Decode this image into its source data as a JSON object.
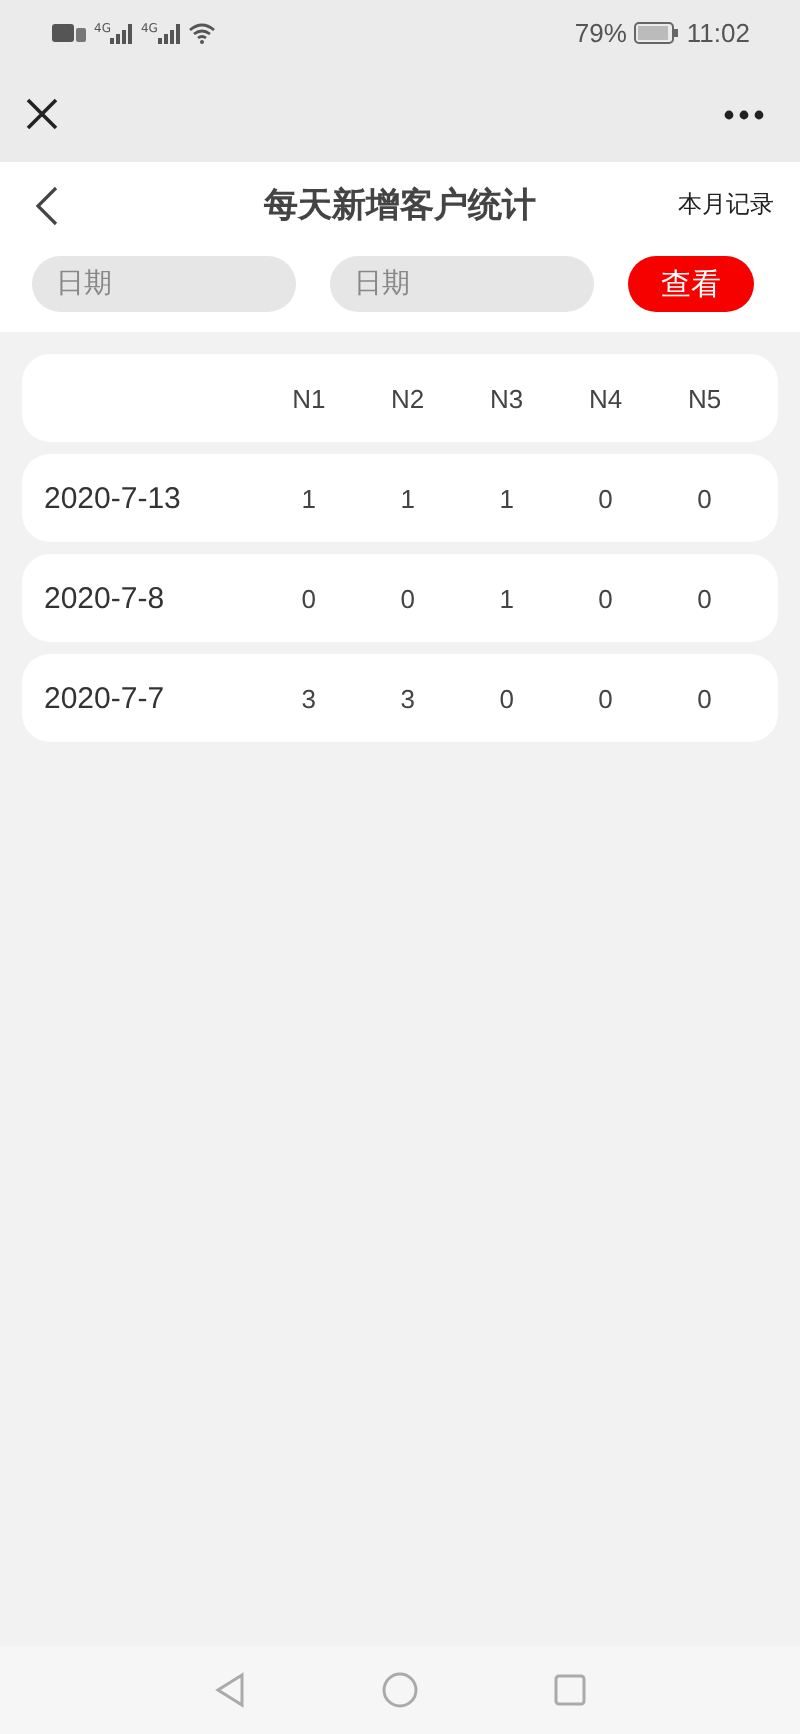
{
  "status_bar": {
    "networks": [
      "4G",
      "4G"
    ],
    "battery": "79%",
    "time": "11:02"
  },
  "header": {
    "title": "每天新增客户统计",
    "action": "本月记录"
  },
  "filters": {
    "start": {
      "placeholder": "日期"
    },
    "end": {
      "placeholder": "日期"
    },
    "button": "查看"
  },
  "table": {
    "columns": [
      "N1",
      "N2",
      "N3",
      "N4",
      "N5"
    ],
    "rows": [
      {
        "date": "2020-7-13",
        "values": [
          "1",
          "1",
          "1",
          "0",
          "0"
        ]
      },
      {
        "date": "2020-7-8",
        "values": [
          "0",
          "0",
          "1",
          "0",
          "0"
        ]
      },
      {
        "date": "2020-7-7",
        "values": [
          "3",
          "3",
          "0",
          "0",
          "0"
        ]
      }
    ]
  }
}
